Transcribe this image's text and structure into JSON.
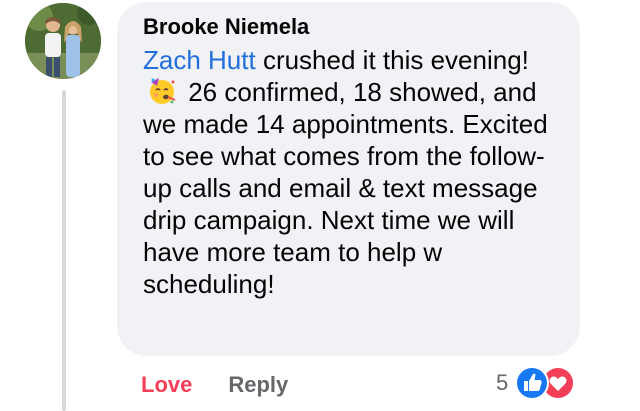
{
  "comment": {
    "author": "Brooke Niemela",
    "mention": "Zach Hutt",
    "text_before_emoji": " crushed it this evening!",
    "emoji": "party-face-emoji",
    "text_after_emoji": " 26 confirmed, 18 showed, and we made 14 appointments. Excited to see what comes from the follow-up calls and email & text message drip campaign. Next time we will have more team to help w scheduling!"
  },
  "actions": {
    "love_label": "Love",
    "reply_label": "Reply"
  },
  "reactions": {
    "count": "5",
    "icons": [
      "like-icon",
      "heart-icon"
    ],
    "colors": {
      "like": "#1877f2",
      "heart": "#f33e58"
    }
  },
  "colors": {
    "bubble_bg": "#f0f2f5",
    "mention": "#216fdb",
    "love": "#f33e58",
    "muted": "#65676b",
    "thread_line": "#d6d9dd"
  }
}
